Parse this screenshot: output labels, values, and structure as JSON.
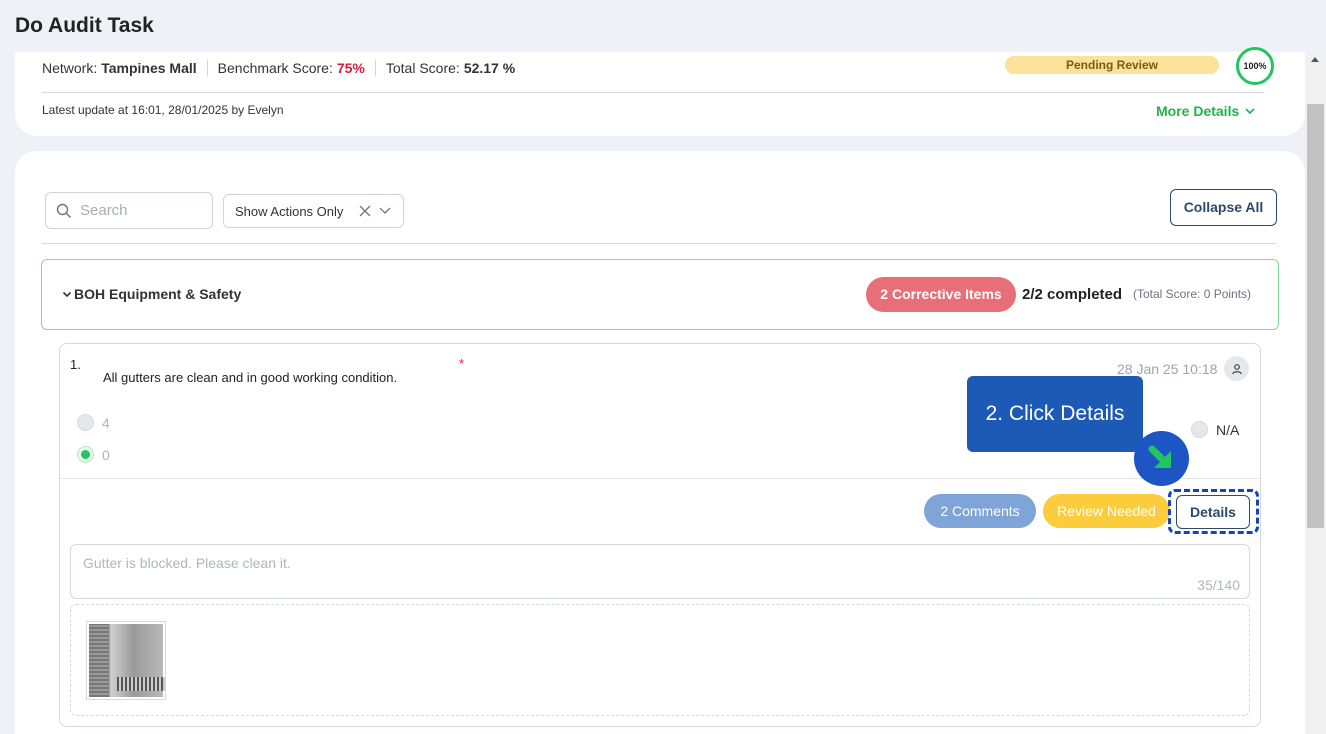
{
  "page": {
    "title": "Do Audit Task"
  },
  "summary": {
    "network_label": "Network:",
    "network_value": "Tampines Mall",
    "benchmark_label": "Benchmark Score:",
    "benchmark_value": "75%",
    "total_label": "Total Score:",
    "total_value": "52.17 %",
    "status": "Pending Review",
    "progress": "100%",
    "latest_update": "Latest update at 16:01, 28/01/2025 by Evelyn",
    "more_details": "More Details"
  },
  "toolbar": {
    "search_placeholder": "Search",
    "filter_value": "Show Actions Only",
    "collapse_all": "Collapse All"
  },
  "section": {
    "title": "BOH Equipment & Safety",
    "corrective": "2 Corrective Items",
    "completed": "2/2 completed",
    "total_score": "(Total Score: 0 Points)"
  },
  "question": {
    "number": "1.",
    "text": "All gutters are clean and in good working condition.",
    "required_mark": "*",
    "timestamp": "28 Jan 25 10:18",
    "options": [
      {
        "label": "4",
        "selected": false
      },
      {
        "label": "0",
        "selected": true
      }
    ],
    "na_label": "N/A",
    "comments_badge": "2 Comments",
    "review_badge": "Review Needed",
    "details_button": "Details",
    "comment_text": "Gutter is blocked. Please clean it.",
    "char_count": "35/140"
  },
  "tutorial": {
    "tooltip": "2. Click Details"
  },
  "colors": {
    "accent_green": "#22c55e",
    "danger_red": "#d61f3c",
    "corrective": "#e86e78",
    "pending": "#fae29a",
    "review": "#fbcd3d",
    "comments": "#7fa4d8",
    "tooltip": "#1c5ab6",
    "navy": "#2d4a6b"
  }
}
